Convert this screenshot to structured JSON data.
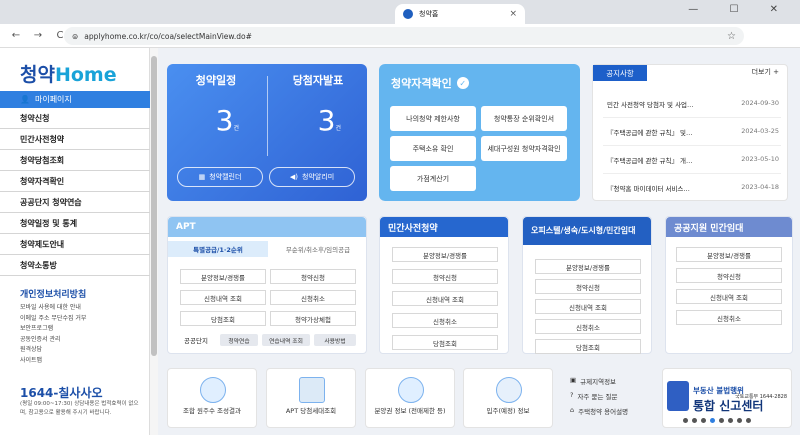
{
  "browser": {
    "tab_title": "청약홈",
    "url": "applyhome.co.kr/co/coa/selectMainView.do#",
    "back": "←",
    "forward": "→",
    "reload": "C",
    "close": "×",
    "star": "☆",
    "win_controls": "—  ☐  ✕"
  },
  "sidebar": {
    "logo_a": "청약",
    "logo_b": "Home",
    "mypage": "마이페이지",
    "items": [
      "청약신청",
      "민간사전청약",
      "청약당첨조회",
      "청약자격확인",
      "공공단지 청약연습",
      "청약일정 및 통계",
      "청약제도안내",
      "청약소통방"
    ],
    "privacy_title": "개인정보처리방침",
    "privacy_links": [
      "모바일 사용에 대한 안내",
      "이메일 주소 무단수집 거부",
      "보안프로그램",
      "공동인증서 관리",
      "원격상담",
      "사이트맵"
    ],
    "phone": "1644-칠사사오",
    "phone_sub": "(평일 09:00~17:30) 상담내용은 법적효력이 없으며, 참고용으로 활용해 주시기 바랍니다."
  },
  "card1": {
    "left_title": "청약일정",
    "right_title": "당첨자발표",
    "left_count": "3",
    "right_count": "3",
    "unit": "건",
    "btn1": "청약캘린더",
    "btn2": "청약알리미"
  },
  "card2": {
    "title": "청약자격확인",
    "buttons": [
      "나의청약 제한사항",
      "청약통장 순위확인서",
      "주택소유 확인",
      "세대구성원 청약자격확인",
      "가점계산기"
    ]
  },
  "notice": {
    "tab": "공지사항",
    "more": "더보기  +",
    "rows": [
      {
        "title": "민간 사전청약 당첨자 및 사업…",
        "date": "2024-09-30"
      },
      {
        "title": "『주택공급에 관한 규칙』 및…",
        "date": "2024-03-25"
      },
      {
        "title": "『주택공급에 관한 규칙』 개…",
        "date": "2023-05-10"
      },
      {
        "title": "『청약홈 마이데이터 서비스…",
        "date": "2023-04-18"
      }
    ]
  },
  "apt": {
    "title": "APT",
    "tab1": "특별공급/1·2순위",
    "tab2": "무순위/취소후/임의공급",
    "buttons": [
      "분양정보/경쟁률",
      "청약신청",
      "신청내역 조회",
      "신청취소",
      "당첨조회",
      "청약가상체험"
    ],
    "public_label": "공공단지",
    "public_buttons": [
      "청약연습",
      "연습내역 조회",
      "사용방법"
    ]
  },
  "presale": {
    "title": "민간사전청약",
    "buttons": [
      "분양정보/경쟁률",
      "청약신청",
      "신청내역 조회",
      "신청취소",
      "당첨조회"
    ]
  },
  "officetel": {
    "title": "오피스텔/생숙/도시형/민간임대",
    "buttons": [
      "분양정보/경쟁률",
      "청약신청",
      "신청내역 조회",
      "신청취소",
      "당첨조회"
    ]
  },
  "public_rental": {
    "title": "공공지원 민간임대",
    "buttons": [
      "분양정보/경쟁률",
      "청약신청",
      "신청내역 조회",
      "신청취소"
    ]
  },
  "bottom": {
    "cards": [
      "조합 원주수 조성결과",
      "APT 당첨세대조회",
      "분양권 정보 (전매제한 등)",
      "입주(예정) 정보"
    ],
    "list": [
      "규제지역정보",
      "자주 묻는 질문",
      "주택청약 용어설명"
    ],
    "banner_top": "부동산 불법행위",
    "banner_main": "통합 신고센터",
    "banner_side": "국토교통부 1644-2828"
  },
  "colors": {
    "primary": "#2f7fe0",
    "dark": "#1c4fa8",
    "apt_head": "#8fc4f2",
    "presale_head": "#2667cf",
    "officetel_head": "#2360c2",
    "rental_head": "#6e8bd0"
  }
}
